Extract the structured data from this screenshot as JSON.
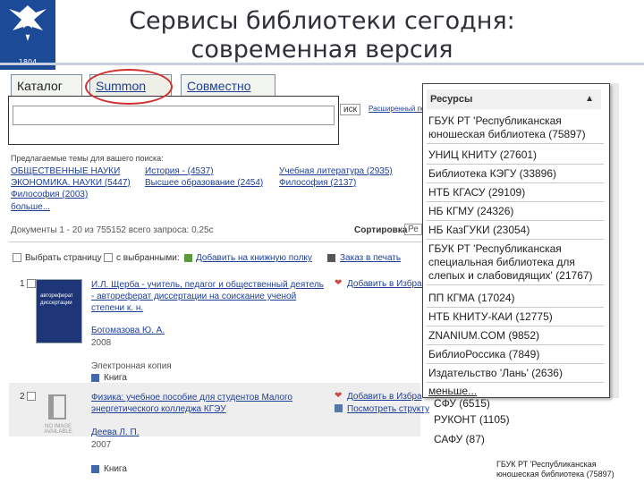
{
  "slide": {
    "title_line1": "Сервисы библиотеки сегодня:",
    "title_line2": "современная версия",
    "logo_year": "1804"
  },
  "tabs": [
    {
      "label": "Каталог"
    },
    {
      "label": "Summon"
    },
    {
      "label": "Совместно"
    }
  ],
  "search": {
    "button_label": "иск",
    "extended_link": "Расширенный поиск"
  },
  "suggest": {
    "heading": "Предлагаемые темы для вашего поиска:",
    "topics": [
      "ОБЩЕСТВЕННЫЕ НАУКИ",
      "История - (4537)",
      "Учебная литература (2935)",
      "ЭКОНОМИКА. НАУКИ (5447)",
      "Высшее образование (2454)",
      "Философия (2137)",
      "Философия (2003)",
      "больше..."
    ]
  },
  "results": {
    "summary": "Документы 1 - 20 из 755152 всего запроса: 0,25с",
    "sort_label": "Сортировка",
    "sort_value": "Ре",
    "select_page": "Выбрать страницу",
    "with_selected": "с выбранными:",
    "add_to_shelf": "Добавить на книжную полку",
    "order_print": "Заказ в печать",
    "items": [
      {
        "index": "1",
        "title": "И.Л. Щерба - учитель, педагог и общественный деятель - автореферат диссертации на соискание ученой степени к. н.",
        "author": "Богомазова Ю. А.",
        "year": "2008",
        "format": "Электронная копия",
        "format_type": "Книга",
        "thumb_text": "автореферат диссертации",
        "action_favorite": "Добавить в Избранное",
        "action_structure": ""
      },
      {
        "index": "2",
        "title": "Физика: учебное пособие для студентов Малого энергетического колледжа КГЭУ",
        "author": "Деева Л. П.",
        "year": "2007",
        "format": "",
        "format_type": "Книга",
        "thumb_text": "NO IMAGE AVAILABLE",
        "action_favorite": "Добавить в Избра",
        "action_structure": "Посмотреть структу"
      }
    ]
  },
  "resources": {
    "header": "Ресурсы",
    "items": [
      "ГБУК РТ 'Республиканская юношеская библиотека (75897)",
      "УНИЦ КНИТУ (27601)",
      "Библиотека КЭГУ (33896)",
      "НТБ КГАСУ (29109)",
      "НБ КГМУ (24326)",
      "НБ КазГУКИ (23054)",
      "ГБУК РТ 'Республиканская специальная библиотека для слепых и слабовидящих' (21767)",
      "ПП КГМА (17024)",
      "НТБ КНИТУ-КАИ (12775)",
      "ZNANIUM.COM (9852)",
      "БиблиоРоссика (7849)",
      "Издательство 'Лань' (2636)",
      "меньше..."
    ]
  },
  "resources_behind": [
    "СФУ (6515)",
    "РУКОНТ (1105)",
    "САФУ (87)",
    "ГБУК РТ 'Республиканская юношеская библиотека (75897)"
  ]
}
